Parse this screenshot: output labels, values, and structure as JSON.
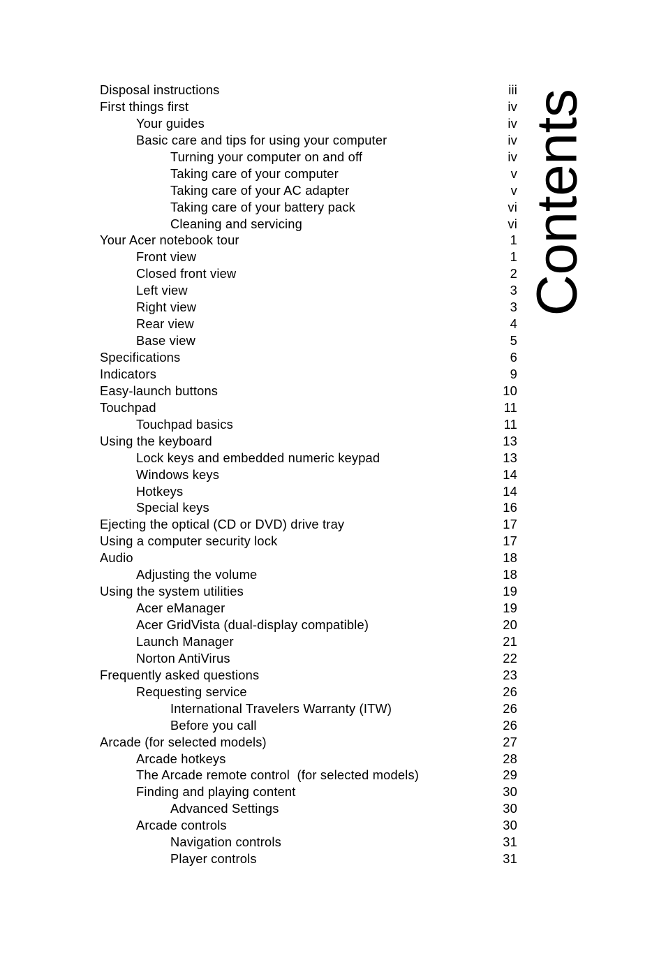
{
  "document": {
    "heading": "Contents",
    "heading_orientation": "vertical-rotated-90-ccw",
    "text_color": "#000000",
    "background_color": "#ffffff"
  },
  "toc": {
    "entries": [
      {
        "title": "Disposal instructions",
        "page": "iii",
        "level": 0
      },
      {
        "title": "First things first",
        "page": "iv",
        "level": 0
      },
      {
        "title": "Your guides",
        "page": "iv",
        "level": 1
      },
      {
        "title": "Basic care and tips for using your computer",
        "page": "iv",
        "level": 1
      },
      {
        "title": "Turning your computer on and off",
        "page": "iv",
        "level": 2
      },
      {
        "title": "Taking care of your computer",
        "page": "v",
        "level": 2
      },
      {
        "title": "Taking care of your AC adapter",
        "page": "v",
        "level": 2
      },
      {
        "title": "Taking care of your battery pack",
        "page": "vi",
        "level": 2
      },
      {
        "title": "Cleaning and servicing",
        "page": "vi",
        "level": 2
      },
      {
        "title": "Your Acer notebook tour",
        "page": "1",
        "level": 0
      },
      {
        "title": "Front view",
        "page": "1",
        "level": 1
      },
      {
        "title": "Closed front view",
        "page": "2",
        "level": 1
      },
      {
        "title": "Left view",
        "page": "3",
        "level": 1
      },
      {
        "title": "Right view",
        "page": "3",
        "level": 1
      },
      {
        "title": "Rear view",
        "page": "4",
        "level": 1
      },
      {
        "title": "Base view",
        "page": "5",
        "level": 1
      },
      {
        "title": "Specifications",
        "page": "6",
        "level": 0
      },
      {
        "title": "Indicators",
        "page": "9",
        "level": 0
      },
      {
        "title": "Easy-launch buttons",
        "page": "10",
        "level": 0
      },
      {
        "title": "Touchpad",
        "page": "11",
        "level": 0
      },
      {
        "title": "Touchpad basics",
        "page": "11",
        "level": 1
      },
      {
        "title": "Using the keyboard",
        "page": "13",
        "level": 0
      },
      {
        "title": "Lock keys and embedded numeric keypad",
        "page": "13",
        "level": 1
      },
      {
        "title": "Windows keys",
        "page": "14",
        "level": 1
      },
      {
        "title": "Hotkeys",
        "page": "14",
        "level": 1
      },
      {
        "title": "Special keys",
        "page": "16",
        "level": 1
      },
      {
        "title": "Ejecting the optical (CD or DVD) drive tray",
        "page": "17",
        "level": 0
      },
      {
        "title": "Using a computer security lock",
        "page": "17",
        "level": 0
      },
      {
        "title": "Audio",
        "page": "18",
        "level": 0
      },
      {
        "title": "Adjusting the volume",
        "page": "18",
        "level": 1
      },
      {
        "title": "Using the system utilities",
        "page": "19",
        "level": 0
      },
      {
        "title": "Acer eManager",
        "page": "19",
        "level": 1
      },
      {
        "title": "Acer GridVista (dual-display compatible)",
        "page": "20",
        "level": 1
      },
      {
        "title": "Launch Manager",
        "page": "21",
        "level": 1
      },
      {
        "title": "Norton AntiVirus",
        "page": "22",
        "level": 1
      },
      {
        "title": "Frequently asked questions",
        "page": "23",
        "level": 0
      },
      {
        "title": "Requesting service",
        "page": "26",
        "level": 1
      },
      {
        "title": "International Travelers Warranty (ITW)",
        "page": "26",
        "level": 2
      },
      {
        "title": "Before you call",
        "page": "26",
        "level": 2
      },
      {
        "title": "Arcade (for selected models)",
        "page": "27",
        "level": 0
      },
      {
        "title": "Arcade hotkeys",
        "page": "28",
        "level": 1
      },
      {
        "title": "The Arcade remote control  (for selected models)",
        "page": "29",
        "level": 1
      },
      {
        "title": "Finding and playing content",
        "page": "30",
        "level": 1
      },
      {
        "title": "Advanced Settings",
        "page": "30",
        "level": 2
      },
      {
        "title": "Arcade controls",
        "page": "30",
        "level": 1
      },
      {
        "title": "Navigation controls",
        "page": "31",
        "level": 2
      },
      {
        "title": "Player controls",
        "page": "31",
        "level": 2
      }
    ]
  }
}
